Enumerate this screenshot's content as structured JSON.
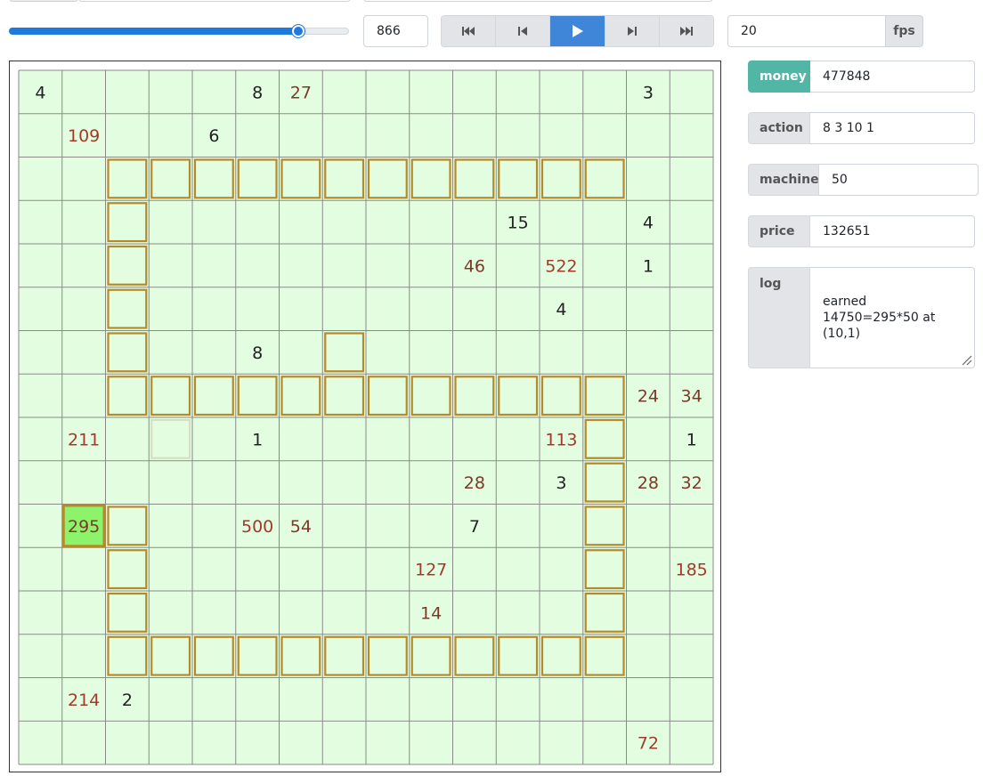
{
  "controls": {
    "turn_slider": {
      "max": 1000,
      "value": 866
    },
    "turn": "866",
    "fps": "20",
    "fps_label": "fps",
    "buttons": [
      {
        "name": "first-button",
        "icon": "skip-to-start-icon"
      },
      {
        "name": "prev-button",
        "icon": "step-back-icon"
      },
      {
        "name": "play-button",
        "icon": "play-icon",
        "active": true
      },
      {
        "name": "next-button",
        "icon": "step-forward-icon"
      },
      {
        "name": "last-button",
        "icon": "skip-to-end-icon"
      }
    ]
  },
  "panel": {
    "money_label": "money",
    "money": "477848",
    "action_label": "action",
    "action": "8 3 10 1",
    "machines_label": "machines",
    "machines": "50",
    "price_label": "price",
    "price": "132651",
    "log_label": "log",
    "log": "earned\n14750=295*50 at\n(10,1)"
  },
  "colors": {
    "accent_blue": "#1f7ae0",
    "play_active": "#3f86d9",
    "money_label_bg": "#52b6a7",
    "cell_bg": "#e3fde0",
    "machine_border": "#b58a2a",
    "harvest_cell": "#8cf36a",
    "value_dark": "#222222",
    "value_brown": "#7a3a2a",
    "value_red": "#a23a2a"
  },
  "board": {
    "size": 16,
    "values": [
      [
        0,
        0,
        "4",
        "dark"
      ],
      [
        0,
        5,
        "8",
        "dark"
      ],
      [
        0,
        6,
        "27",
        "brown"
      ],
      [
        0,
        14,
        "3",
        "dark"
      ],
      [
        1,
        1,
        "109",
        "red"
      ],
      [
        1,
        4,
        "6",
        "dark"
      ],
      [
        3,
        11,
        "15",
        "dark"
      ],
      [
        3,
        14,
        "4",
        "dark"
      ],
      [
        4,
        10,
        "46",
        "brown"
      ],
      [
        4,
        12,
        "522",
        "red"
      ],
      [
        4,
        14,
        "1",
        "dark"
      ],
      [
        5,
        12,
        "4",
        "dark"
      ],
      [
        6,
        5,
        "8",
        "dark"
      ],
      [
        7,
        14,
        "24",
        "brown"
      ],
      [
        7,
        15,
        "34",
        "brown"
      ],
      [
        8,
        1,
        "211",
        "red"
      ],
      [
        8,
        5,
        "1",
        "dark"
      ],
      [
        8,
        12,
        "113",
        "red"
      ],
      [
        8,
        15,
        "1",
        "dark"
      ],
      [
        9,
        10,
        "28",
        "brown"
      ],
      [
        9,
        12,
        "3",
        "dark"
      ],
      [
        9,
        14,
        "28",
        "brown"
      ],
      [
        9,
        15,
        "32",
        "brown"
      ],
      [
        10,
        1,
        "295",
        "brown"
      ],
      [
        10,
        5,
        "500",
        "red"
      ],
      [
        10,
        6,
        "54",
        "brown"
      ],
      [
        10,
        10,
        "7",
        "dark"
      ],
      [
        11,
        9,
        "127",
        "red"
      ],
      [
        11,
        15,
        "185",
        "red"
      ],
      [
        12,
        9,
        "14",
        "brown"
      ],
      [
        15,
        14,
        "72",
        "red"
      ],
      [
        14,
        1,
        "214",
        "red"
      ],
      [
        14,
        2,
        "2",
        "dark"
      ]
    ],
    "machines": [
      [
        2,
        2
      ],
      [
        2,
        3
      ],
      [
        2,
        4
      ],
      [
        2,
        5
      ],
      [
        2,
        6
      ],
      [
        2,
        7
      ],
      [
        2,
        8
      ],
      [
        2,
        9
      ],
      [
        2,
        10
      ],
      [
        2,
        11
      ],
      [
        2,
        12
      ],
      [
        2,
        13
      ],
      [
        3,
        2
      ],
      [
        4,
        2
      ],
      [
        5,
        2
      ],
      [
        6,
        2
      ],
      [
        6,
        7
      ],
      [
        7,
        2
      ],
      [
        7,
        3
      ],
      [
        7,
        4
      ],
      [
        7,
        5
      ],
      [
        7,
        6
      ],
      [
        7,
        7
      ],
      [
        7,
        8
      ],
      [
        7,
        9
      ],
      [
        7,
        10
      ],
      [
        7,
        11
      ],
      [
        7,
        12
      ],
      [
        7,
        13
      ],
      [
        8,
        13
      ],
      [
        9,
        13
      ],
      [
        10,
        2
      ],
      [
        10,
        13
      ],
      [
        11,
        2
      ],
      [
        11,
        13
      ],
      [
        12,
        2
      ],
      [
        12,
        13
      ],
      [
        13,
        2
      ],
      [
        13,
        3
      ],
      [
        13,
        4
      ],
      [
        13,
        5
      ],
      [
        13,
        6
      ],
      [
        13,
        7
      ],
      [
        13,
        8
      ],
      [
        13,
        9
      ],
      [
        13,
        10
      ],
      [
        13,
        11
      ],
      [
        13,
        12
      ],
      [
        13,
        13
      ]
    ],
    "faded_machine": [
      8,
      3
    ],
    "harvested": [
      10,
      1
    ]
  }
}
